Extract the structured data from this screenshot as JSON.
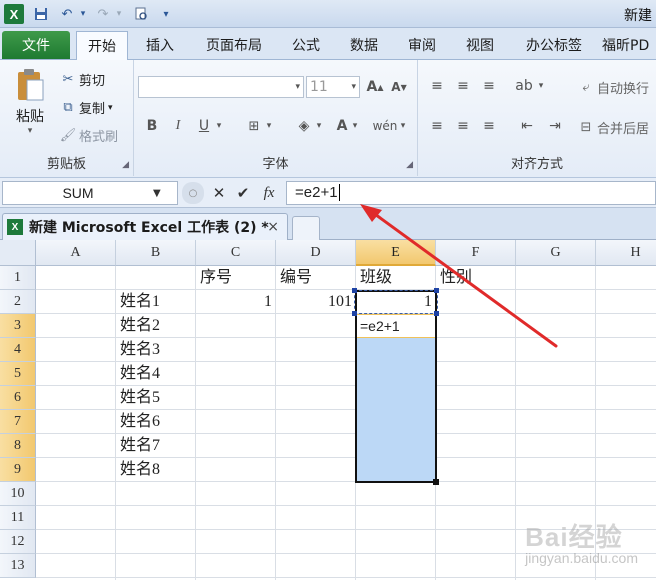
{
  "title_bar": {
    "title": "新建",
    "app_icon_glyph": "X"
  },
  "ribbon_tabs": [
    "文件",
    "开始",
    "插入",
    "页面布局",
    "公式",
    "数据",
    "审阅",
    "视图",
    "办公标签",
    "福昕PD"
  ],
  "active_tab": 1,
  "clipboard": {
    "paste_label": "粘贴",
    "cut_label": "剪切",
    "copy_label": "复制",
    "format_painter_label": "格式刷",
    "group_label": "剪贴板"
  },
  "font": {
    "name_value": "",
    "size_value": "11",
    "group_label": "字体"
  },
  "alignment": {
    "wrap_label": "自动换行",
    "merge_label": "合并后居",
    "group_label": "对齐方式"
  },
  "formula_bar": {
    "name_box": "SUM",
    "formula": "=e2+1",
    "fx_label": "fx"
  },
  "workbook": {
    "title": "新建 Microsoft Excel 工作表 (2) *",
    "close_glyph": "×"
  },
  "columns": [
    "A",
    "B",
    "C",
    "D",
    "E",
    "F",
    "G",
    "H"
  ],
  "rows": [
    "1",
    "2",
    "3",
    "4",
    "5",
    "6",
    "7",
    "8",
    "9",
    "10",
    "11",
    "12",
    "13"
  ],
  "cells": {
    "C1": "序号",
    "D1": "编号",
    "E1": "班级",
    "F1": "性别",
    "B2": "姓名1",
    "C2": "1",
    "D2": "101",
    "E2": "1",
    "B3": "姓名2",
    "E3": "=e2+1",
    "B4": "姓名3",
    "B5": "姓名4",
    "B6": "姓名5",
    "B7": "姓名6",
    "B8": "姓名7",
    "B9": "姓名8"
  },
  "watermark": {
    "brand": "Bai经验",
    "sub": "jingyan.baidu.com"
  },
  "colors": {
    "accent_green": "#1e7a31",
    "selection_blue": "#bcd8f6",
    "arrow_red": "#e02a2a"
  }
}
